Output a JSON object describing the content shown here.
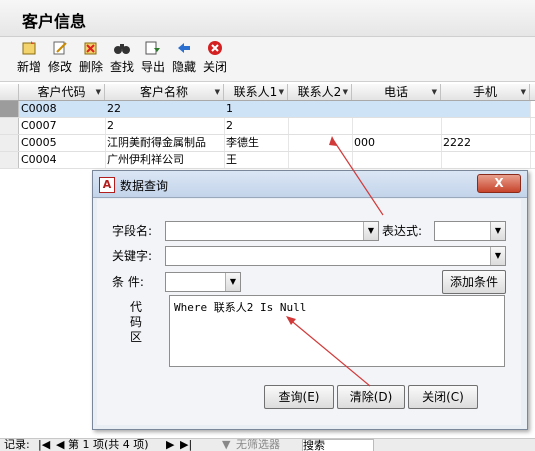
{
  "window": {
    "title": "客户信息"
  },
  "toolbar": {
    "buttons": [
      {
        "label": "新增",
        "icon": "new-icon"
      },
      {
        "label": "修改",
        "icon": "edit-icon"
      },
      {
        "label": "删除",
        "icon": "delete-icon"
      },
      {
        "label": "查找",
        "icon": "binoculars-icon"
      },
      {
        "label": "导出",
        "icon": "export-icon"
      },
      {
        "label": "隐藏",
        "icon": "arrow-left-icon"
      },
      {
        "label": "关闭",
        "icon": "close-icon"
      }
    ]
  },
  "grid": {
    "columns": [
      "客户代码",
      "客户名称",
      "联系人1",
      "联系人2",
      "电话",
      "手机"
    ],
    "rows": [
      [
        "C0008",
        "22",
        "1",
        "",
        "",
        ""
      ],
      [
        "C0007",
        "2",
        "2",
        "",
        "",
        ""
      ],
      [
        "C0005",
        "江阴美耐得金属制品",
        "李德生",
        "",
        "000",
        "2222"
      ],
      [
        "C0004",
        "广州伊利祥公司",
        "王",
        "",
        "",
        ""
      ]
    ],
    "selected_row": 0
  },
  "statusbar": {
    "record_label": "记录:",
    "position": "第 1 项(共 4 项)",
    "filter": "无筛选器",
    "search": "搜索"
  },
  "dialog": {
    "title": "数据查询",
    "close_label": "X",
    "field_label": "字段名:",
    "field_value": "",
    "expr_label": "表达式:",
    "expr_value": "",
    "keyword_label": "关键字:",
    "keyword_value": "",
    "condition_label": "条    件:",
    "condition_value": "",
    "add_condition_label": "添加条件",
    "code_label_1": "代",
    "code_label_2": "码",
    "code_label_3": "区",
    "code_text": "Where 联系人2 Is Null",
    "query_label": "查询(E)",
    "clear_label": "清除(D)",
    "close_btn_label": "关闭(C)"
  },
  "colors": {
    "arrow": "#d23a3a",
    "selected_row": "#cfe3f7",
    "close_button": "#c8442b"
  }
}
